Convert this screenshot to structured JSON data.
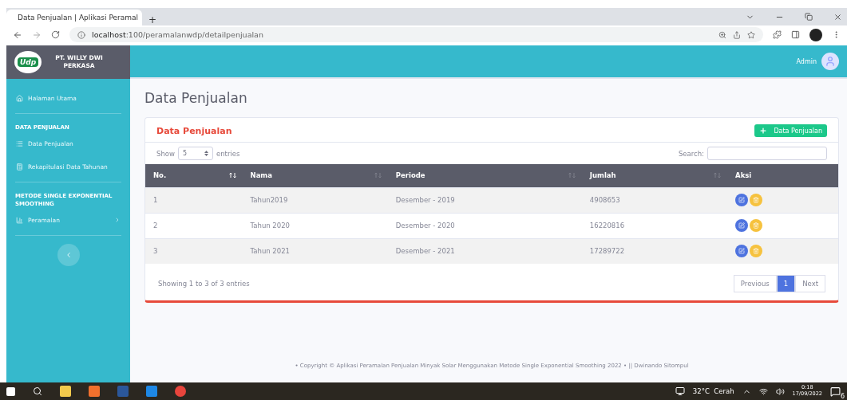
{
  "browser": {
    "tab_title": "Data Penjualan | Aplikasi Peramal",
    "new_tab": "+",
    "url_host": "localhost",
    "url_path": ":100/peramalanwdp/detailpenjualan"
  },
  "brand": {
    "logo": "Udp",
    "name": "PT. WILLY DWI PERKASA"
  },
  "header": {
    "user": "Admin"
  },
  "sidebar": {
    "items": [
      {
        "kind": "link",
        "label": "Halaman Utama",
        "chevron": false
      },
      {
        "kind": "divider"
      },
      {
        "kind": "heading",
        "label": "DATA PENJUALAN"
      },
      {
        "kind": "link",
        "label": "Data Penjualan",
        "chevron": false
      },
      {
        "kind": "link",
        "label": "Rekapitulasi Data Tahunan",
        "chevron": false
      },
      {
        "kind": "divider"
      },
      {
        "kind": "heading",
        "label": "METODE SINGLE EXPONENTIAL SMOOTHING"
      },
      {
        "kind": "link",
        "label": "Peramalan",
        "chevron": true
      },
      {
        "kind": "divider"
      }
    ]
  },
  "page_title": "Data Penjualan",
  "card": {
    "title": "Data Penjualan",
    "add_button": "Data Penjualan",
    "length": {
      "before": "Show",
      "value": "5",
      "after": "entries"
    },
    "search_label": "Search:",
    "columns": [
      {
        "label": "No.",
        "sorted": true
      },
      {
        "label": "Nama",
        "sorted": false
      },
      {
        "label": "Periode",
        "sorted": false
      },
      {
        "label": "Jumlah",
        "sorted": false
      },
      {
        "label": "Aksi"
      }
    ],
    "rows": [
      {
        "no": "1",
        "nama": "Tahun2019",
        "periode": "Desember - 2019",
        "jumlah": "4908653"
      },
      {
        "no": "2",
        "nama": "Tahun 2020",
        "periode": "Desember - 2020",
        "jumlah": "16220816"
      },
      {
        "no": "3",
        "nama": "Tahun 2021",
        "periode": "Desember - 2021",
        "jumlah": "17289722"
      }
    ],
    "info": "Showing 1 to 3 of 3 entries",
    "pages": [
      {
        "label": "Previous",
        "selected": false
      },
      {
        "label": "1",
        "selected": true
      },
      {
        "label": "Next",
        "selected": false
      }
    ]
  },
  "footer": "• Copyright © Aplikasi Peramalan Penjualan Minyak Solar Menggunakan Metode Single Exponential Smoothing 2022 • || Dwinando Sitompul",
  "taskbar": {
    "weather": "32°C  Cerah",
    "time": "0:18",
    "date": "17/09/2022",
    "notifications": "6"
  }
}
